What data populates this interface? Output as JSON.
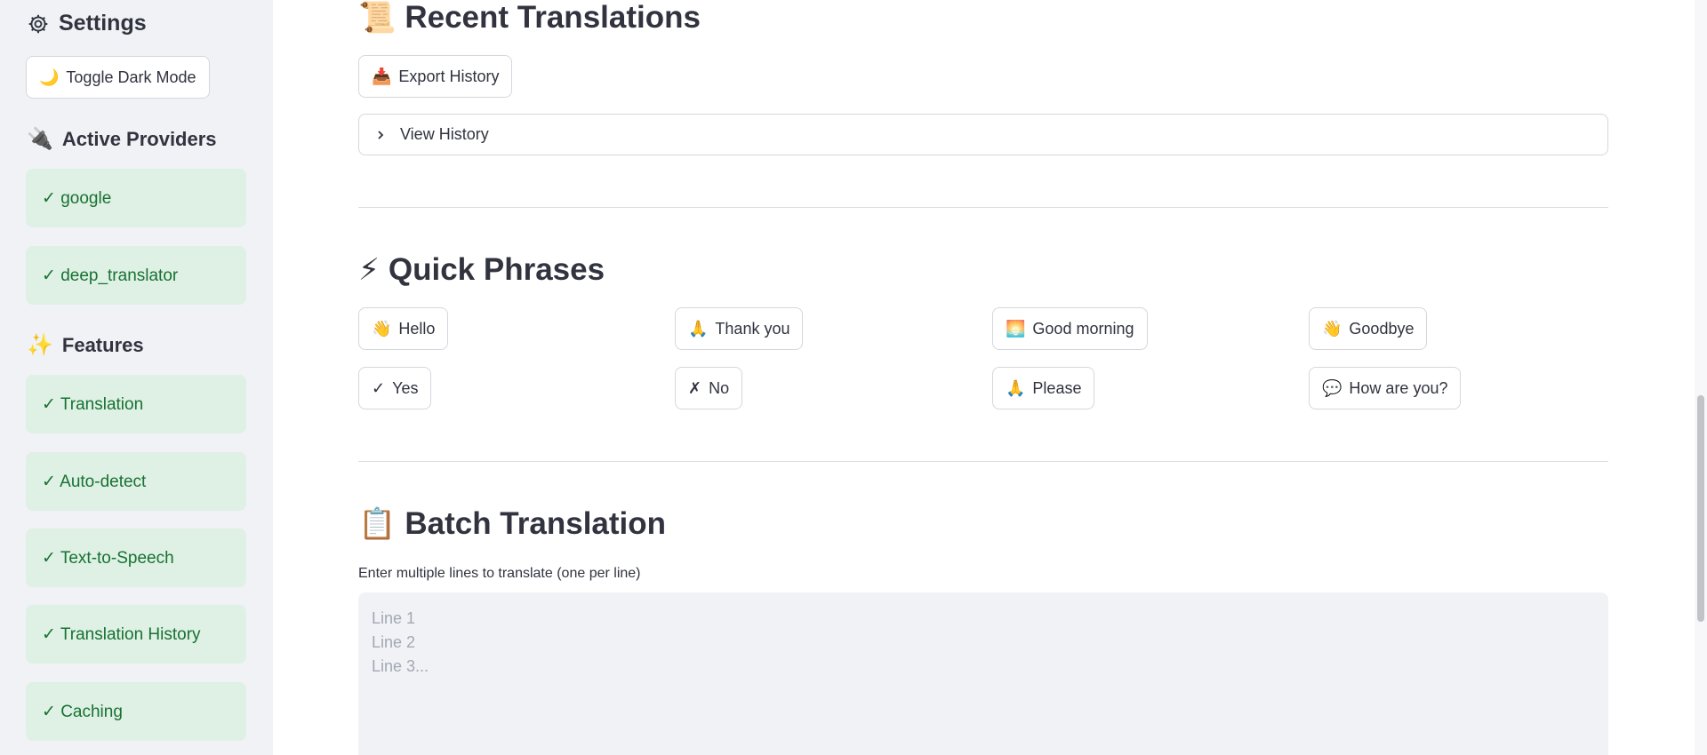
{
  "sidebar": {
    "settings_title": "Settings",
    "dark_mode_button": {
      "emoji": "🌙",
      "label": "Toggle Dark Mode"
    },
    "providers_title": {
      "emoji": "🔌",
      "label": "Active Providers"
    },
    "providers": [
      "✓ google",
      "✓ deep_translator"
    ],
    "features_title": {
      "emoji": "✨",
      "label": "Features"
    },
    "features": [
      "✓ Translation",
      "✓ Auto-detect",
      "✓ Text-to-Speech",
      "✓ Translation History",
      "✓ Caching"
    ]
  },
  "recent": {
    "title": {
      "emoji": "📜",
      "label": "Recent Translations"
    },
    "export_button": {
      "emoji": "📥",
      "label": "Export History"
    },
    "expander_label": "View History"
  },
  "quick": {
    "title": {
      "emoji": "⚡",
      "label": "Quick Phrases"
    },
    "phrases": [
      {
        "emoji": "👋",
        "label": "Hello"
      },
      {
        "emoji": "🙏",
        "label": "Thank you"
      },
      {
        "emoji": "🌅",
        "label": "Good morning"
      },
      {
        "emoji": "👋",
        "label": "Goodbye"
      },
      {
        "emoji": "✓",
        "label": "Yes"
      },
      {
        "emoji": "✗",
        "label": "No"
      },
      {
        "emoji": "🙏",
        "label": "Please"
      },
      {
        "emoji": "💬",
        "label": "How are you?"
      }
    ]
  },
  "batch": {
    "title": {
      "emoji": "📋",
      "label": "Batch Translation"
    },
    "input_label": "Enter multiple lines to translate (one per line)",
    "placeholder": "Line 1\nLine 2\nLine 3..."
  },
  "colors": {
    "sidebar_bg": "#f0f2f6",
    "success_bg": "#dff0e4",
    "success_text": "#177233"
  }
}
